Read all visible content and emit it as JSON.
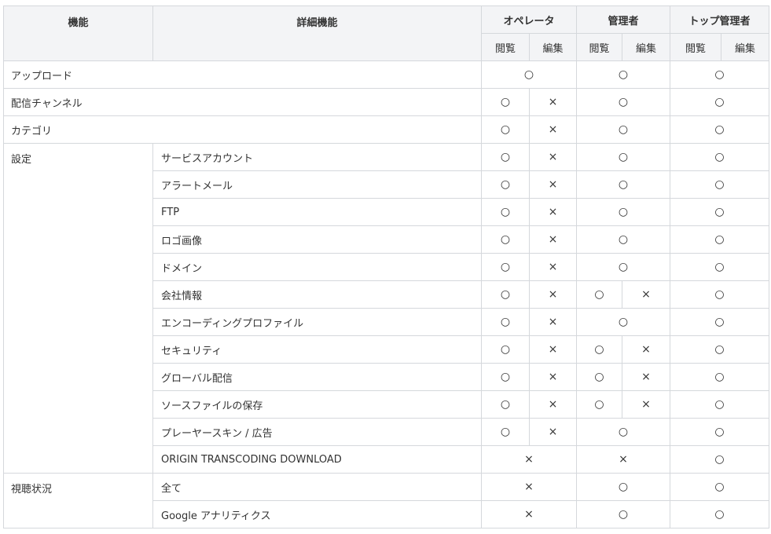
{
  "header": {
    "feature": "機能",
    "detail": "詳細機能",
    "roles": [
      "オペレータ",
      "管理者",
      "トップ管理者"
    ],
    "view": "閲覧",
    "edit": "編集"
  },
  "marks": {
    "yes": "○",
    "no": "×"
  },
  "rows": [
    {
      "feature": "アップロード",
      "detail": "",
      "op": [
        "○"
      ],
      "admin": [
        "○"
      ],
      "top": "○"
    },
    {
      "feature": "配信チャンネル",
      "detail": "",
      "op": [
        "○",
        "×"
      ],
      "admin": [
        "○"
      ],
      "top": "○"
    },
    {
      "feature": "カテゴリ",
      "detail": "",
      "op": [
        "○",
        "×"
      ],
      "admin": [
        "○"
      ],
      "top": "○"
    },
    {
      "feature": "設定",
      "detail": "サービスアカウント",
      "op": [
        "○",
        "×"
      ],
      "admin": [
        "○"
      ],
      "top": "○"
    },
    {
      "feature": "",
      "detail": "アラートメール",
      "op": [
        "○",
        "×"
      ],
      "admin": [
        "○"
      ],
      "top": "○"
    },
    {
      "feature": "",
      "detail": "FTP",
      "op": [
        "○",
        "×"
      ],
      "admin": [
        "○"
      ],
      "top": "○"
    },
    {
      "feature": "",
      "detail": "ロゴ画像",
      "op": [
        "○",
        "×"
      ],
      "admin": [
        "○"
      ],
      "top": "○"
    },
    {
      "feature": "",
      "detail": "ドメイン",
      "op": [
        "○",
        "×"
      ],
      "admin": [
        "○"
      ],
      "top": "○"
    },
    {
      "feature": "",
      "detail": "会社情報",
      "op": [
        "○",
        "×"
      ],
      "admin": [
        "○",
        "×"
      ],
      "top": "○"
    },
    {
      "feature": "",
      "detail": "エンコーディングプロファイル",
      "op": [
        "○",
        "×"
      ],
      "admin": [
        "○"
      ],
      "top": "○"
    },
    {
      "feature": "",
      "detail": "セキュリティ",
      "op": [
        "○",
        "×"
      ],
      "admin": [
        "○",
        "×"
      ],
      "top": "○"
    },
    {
      "feature": "",
      "detail": "グローバル配信",
      "op": [
        "○",
        "×"
      ],
      "admin": [
        "○",
        "×"
      ],
      "top": "○"
    },
    {
      "feature": "",
      "detail": "ソースファイルの保存",
      "op": [
        "○",
        "×"
      ],
      "admin": [
        "○",
        "×"
      ],
      "top": "○"
    },
    {
      "feature": "",
      "detail": "プレーヤースキン / 広告",
      "op": [
        "○",
        "×"
      ],
      "admin": [
        "○"
      ],
      "top": "○"
    },
    {
      "feature": "",
      "detail": "ORIGIN TRANSCODING DOWNLOAD",
      "op": [
        "×"
      ],
      "admin": [
        "×"
      ],
      "top": "○"
    },
    {
      "feature": "視聴状況",
      "detail": "全て",
      "op": [
        "×"
      ],
      "admin": [
        "○"
      ],
      "top": "○"
    },
    {
      "feature": "",
      "detail": "Google アナリティクス",
      "op": [
        "×"
      ],
      "admin": [
        "○"
      ],
      "top": "○"
    }
  ]
}
